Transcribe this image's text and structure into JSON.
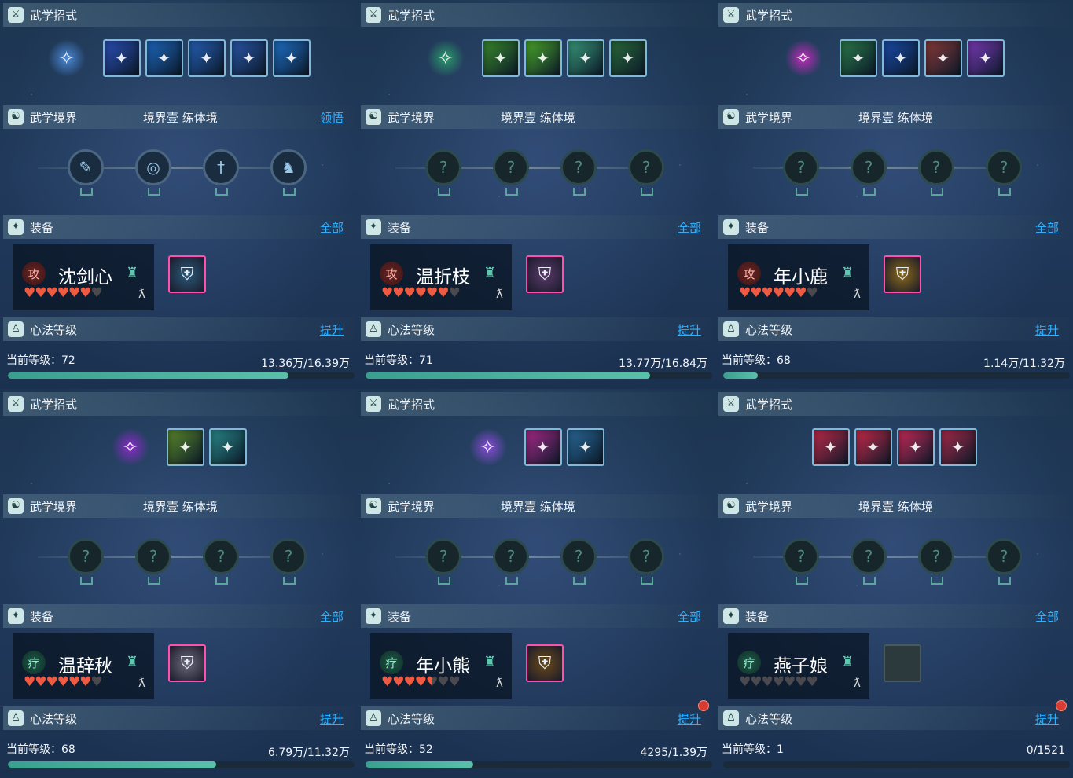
{
  "labels": {
    "skills_title": "武学招式",
    "realm_title": "武学境界",
    "equip_title": "装备",
    "equip_all": "全部",
    "heart_title": "心法等级",
    "level_prefix": "当前等级："
  },
  "colors": {
    "accent_link": "#2fb0ff",
    "progress_fill": "#3aa08e",
    "heart_on": "#ef5a42",
    "heart_off": "#4a4a4e",
    "gear_border": "#ff4fb0"
  },
  "panels": [
    {
      "realm_level": "境界壹",
      "realm_stage": "练体境",
      "realm_link": "领悟",
      "skill_main": {
        "icon": "swirl-orb-icon",
        "color": "#4a8ad8"
      },
      "skills": [
        {
          "icon": "blade-slash-icon",
          "color": "#2a4fb8"
        },
        {
          "icon": "water-vortex-icon",
          "color": "#1d68c0"
        },
        {
          "icon": "sword-wave-icon",
          "color": "#2660b8"
        },
        {
          "icon": "lightning-blade-icon",
          "color": "#2a56a8"
        },
        {
          "icon": "leaping-figure-icon",
          "color": "#1f70c8"
        }
      ],
      "nodes": [
        "feather-icon",
        "swirl-icon",
        "sword-icon",
        "figure-icon"
      ],
      "nodes_active": true,
      "role": "攻",
      "role_type": "atk",
      "name": "沈剑心",
      "hearts": 6,
      "hearts_max": 7,
      "gear": {
        "icon": "armor-icon",
        "empty": false,
        "color": "#2a5a7a"
      },
      "level": "72",
      "progress_text": "13.36万/16.39万",
      "progress": 0.81,
      "heart_link": "提升",
      "heart_dot": false
    },
    {
      "realm_level": "境界壹",
      "realm_stage": "练体境",
      "realm_link": "",
      "skill_main": {
        "icon": "green-figure-icon",
        "color": "#2a9a6a"
      },
      "skills": [
        {
          "icon": "vine-slash-icon",
          "color": "#3a8a2a"
        },
        {
          "icon": "leaf-strike-icon",
          "color": "#4aa82a"
        },
        {
          "icon": "ring-icon",
          "color": "#3a9a7a"
        },
        {
          "icon": "yin-yang-icon",
          "color": "#2a6a3a"
        }
      ],
      "nodes": [
        "locked-icon",
        "locked-icon",
        "locked-icon",
        "locked-icon"
      ],
      "nodes_active": false,
      "role": "攻",
      "role_type": "atk",
      "name": "温折枝",
      "hearts": 6,
      "hearts_max": 7,
      "gear": {
        "icon": "armor-icon",
        "empty": false,
        "color": "#5a3a6a"
      },
      "level": "71",
      "progress_text": "13.77万/16.84万",
      "progress": 0.82,
      "heart_link": "提升",
      "heart_dot": false
    },
    {
      "realm_level": "境界壹",
      "realm_stage": "练体境",
      "realm_link": "",
      "skill_main": {
        "icon": "magenta-orb-icon",
        "color": "#c02ab8"
      },
      "skills": [
        {
          "icon": "green-fist-icon",
          "color": "#2a7a4a"
        },
        {
          "icon": "blue-serpent-icon",
          "color": "#1a4aa8"
        },
        {
          "icon": "red-beast-icon",
          "color": "#8a3a3a"
        },
        {
          "icon": "purple-wave-icon",
          "color": "#7a3ab8"
        }
      ],
      "nodes": [
        "locked-icon",
        "locked-icon",
        "locked-icon",
        "locked-icon"
      ],
      "nodes_active": false,
      "role": "攻",
      "role_type": "atk",
      "name": "年小鹿",
      "hearts": 6,
      "hearts_max": 7,
      "gear": {
        "icon": "armor-icon",
        "empty": false,
        "color": "#8a6a1a"
      },
      "level": "68",
      "progress_text": "1.14万/11.32万",
      "progress": 0.1,
      "heart_link": "提升",
      "heart_dot": false
    },
    {
      "realm_level": "境界壹",
      "realm_stage": "练体境",
      "realm_link": "",
      "skill_main": {
        "icon": "violet-figure-icon",
        "color": "#8a2ac8"
      },
      "skills": [
        {
          "icon": "tree-hands-icon",
          "color": "#5a8a2a"
        },
        {
          "icon": "swirl-icon",
          "color": "#2a8a8a"
        }
      ],
      "nodes": [
        "locked-icon",
        "locked-icon",
        "locked-icon",
        "locked-icon"
      ],
      "nodes_active": false,
      "role": "疗",
      "role_type": "heal",
      "name": "温辞秋",
      "hearts": 6,
      "hearts_max": 7,
      "gear": {
        "icon": "armor-icon",
        "empty": false,
        "color": "#6a6a7a"
      },
      "level": "68",
      "progress_text": "6.79万/11.32万",
      "progress": 0.6,
      "heart_link": "提升",
      "heart_dot": false
    },
    {
      "realm_level": "境界壹",
      "realm_stage": "练体境",
      "realm_link": "",
      "skill_main": {
        "icon": "crystal-icon",
        "color": "#8a4ad8"
      },
      "skills": [
        {
          "icon": "dragon-icon",
          "color": "#a82a8a"
        },
        {
          "icon": "shell-icon",
          "color": "#2a6a9a"
        }
      ],
      "nodes": [
        "locked-icon",
        "locked-icon",
        "locked-icon",
        "locked-icon"
      ],
      "nodes_active": false,
      "role": "疗",
      "role_type": "heal",
      "name": "年小熊",
      "hearts": 4.5,
      "hearts_max": 7,
      "gear": {
        "icon": "armor-icon",
        "empty": false,
        "color": "#6a4a1a"
      },
      "level": "52",
      "progress_text": "4295/1.39万",
      "progress": 0.31,
      "heart_link": "提升",
      "heart_dot": true
    },
    {
      "realm_level": "境界壹",
      "realm_stage": "练体境",
      "realm_link": "",
      "skill_main": null,
      "skills": [
        {
          "icon": "red-slash-icon",
          "color": "#c02a4a"
        },
        {
          "icon": "red-slash-icon",
          "color": "#c82a4a"
        },
        {
          "icon": "rose-icon",
          "color": "#c82a5a"
        },
        {
          "icon": "red-figure-icon",
          "color": "#a82a4a"
        }
      ],
      "nodes": [
        "locked-icon",
        "locked-icon",
        "locked-icon",
        "locked-icon"
      ],
      "nodes_active": false,
      "role": "疗",
      "role_type": "heal",
      "name": "燕子娘",
      "hearts": 0,
      "hearts_max": 7,
      "gear": {
        "icon": "armor-slot-icon",
        "empty": true,
        "color": "#2c3a3e"
      },
      "level": "1",
      "progress_text": "0/1521",
      "progress": 0,
      "heart_link": "提升",
      "heart_dot": true
    }
  ]
}
